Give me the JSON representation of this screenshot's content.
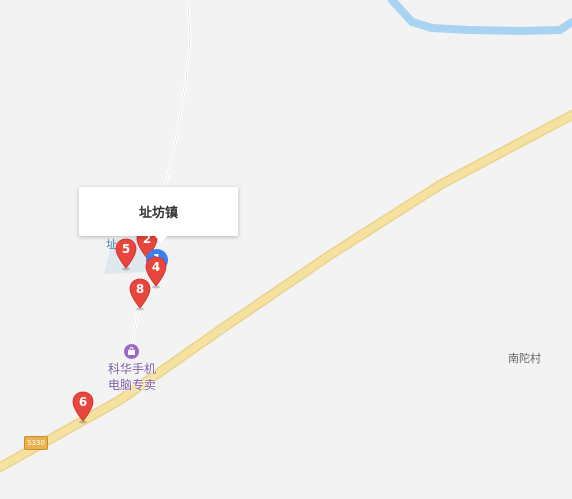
{
  "map": {
    "colors": {
      "background": "#f3f3f3",
      "highway": "#f6e2a0",
      "highway_edge": "#ecd28a",
      "river": "#a9d3f2",
      "minor_road": "#ffffff",
      "pin_red": "#e8453c",
      "current_location": "#3a7ff0",
      "poi_purple": "#9b6ac7",
      "town_area": "#dfe8ee"
    },
    "callout": {
      "title": "址坊镇"
    },
    "town_label_partial": "址",
    "markers": [
      {
        "id": "5",
        "label": "5"
      },
      {
        "id": "2",
        "label": "2"
      },
      {
        "id": "1",
        "label": "1"
      },
      {
        "id": "4",
        "label": "4"
      },
      {
        "id": "8",
        "label": "8"
      },
      {
        "id": "6",
        "label": "6"
      }
    ],
    "poi": {
      "name_line1": "科华手机",
      "name_line2": "电脑专卖",
      "icon": "shopping-bag-icon"
    },
    "village": {
      "name": "南陀村"
    },
    "route_shield": {
      "label": "S330"
    }
  }
}
